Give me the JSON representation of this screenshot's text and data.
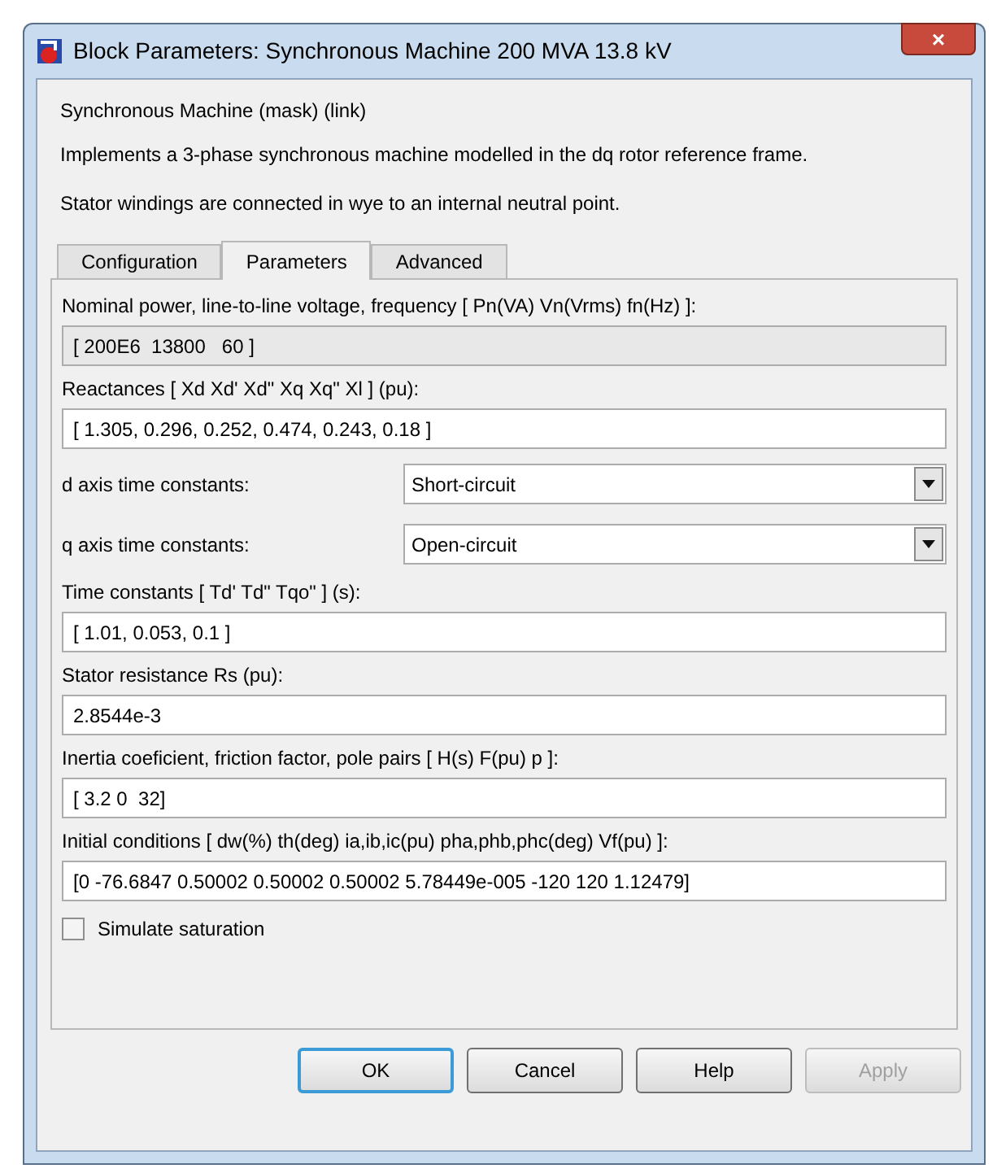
{
  "window": {
    "title": "Block Parameters: Synchronous Machine 200 MVA 13.8 kV",
    "close": "×"
  },
  "header": {
    "block_name": "Synchronous Machine (mask) (link)",
    "description": [
      "Implements a 3-phase synchronous machine modelled in the dq rotor reference frame.",
      "Stator windings are connected in wye to an internal neutral point."
    ]
  },
  "tabs": [
    {
      "label": "Configuration",
      "selected": false
    },
    {
      "label": "Parameters",
      "selected": true
    },
    {
      "label": "Advanced",
      "selected": false
    }
  ],
  "parameters": [
    {
      "kind": "text",
      "label": "Nominal power, line-to-line voltage, frequency [ Pn(VA)  Vn(Vrms)  fn(Hz) ]:",
      "value": "[ 200E6  13800   60 ]",
      "disabled": true
    },
    {
      "kind": "text",
      "label": "Reactances [ Xd  Xd'  Xd\"  Xq  Xq\"  Xl ] (pu):",
      "value": "[ 1.305, 0.296, 0.252, 0.474, 0.243, 0.18 ]",
      "disabled": false
    },
    {
      "kind": "popup",
      "label": "d axis time constants:",
      "value": "Short-circuit"
    },
    {
      "kind": "popup",
      "label": "q axis time constants:",
      "value": "Open-circuit"
    },
    {
      "kind": "text",
      "label": "Time constants [ Td'  Td\"  Tqo\" ] (s):",
      "value": "[ 1.01, 0.053, 0.1 ]",
      "disabled": false
    },
    {
      "kind": "text",
      "label": "Stator resistance Rs (pu):",
      "value": "2.8544e-3",
      "disabled": false
    },
    {
      "kind": "text",
      "label": "Inertia coeficient, friction factor, pole pairs [ H(s)  F(pu)  p ]:",
      "value": "[ 3.2 0  32]",
      "disabled": false
    },
    {
      "kind": "text",
      "label": "Initial conditions [ dw(%)  th(deg)  ia,ib,ic(pu)  pha,phb,phc(deg)  Vf(pu) ]:",
      "value": "[0 -76.6847 0.50002 0.50002 0.50002 5.78449e-005 -120 120 1.12479]",
      "disabled": false
    },
    {
      "kind": "checkbox",
      "label": "Simulate saturation",
      "checked": false
    }
  ],
  "buttons": [
    {
      "label": "OK",
      "default": true,
      "disabled": false
    },
    {
      "label": "Cancel",
      "default": false,
      "disabled": false
    },
    {
      "label": "Help",
      "default": false,
      "disabled": false
    },
    {
      "label": "Apply",
      "default": false,
      "disabled": true
    }
  ]
}
